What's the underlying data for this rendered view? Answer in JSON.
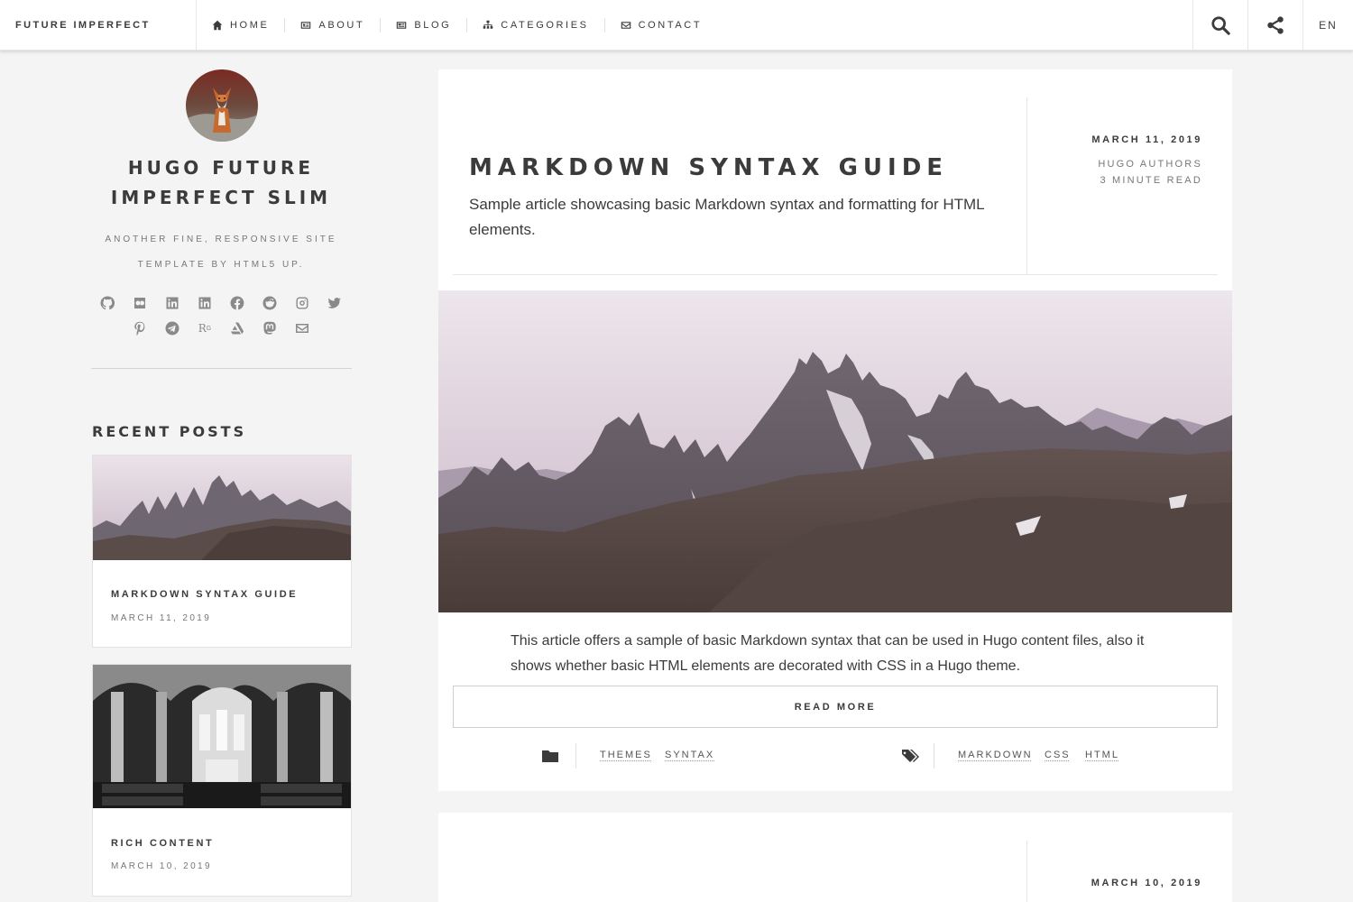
{
  "header": {
    "brand": "FUTURE IMPERFECT",
    "nav": [
      {
        "label": "HOME",
        "icon": "home-icon"
      },
      {
        "label": "ABOUT",
        "icon": "id-card-icon"
      },
      {
        "label": "BLOG",
        "icon": "newspaper-icon"
      },
      {
        "label": "CATEGORIES",
        "icon": "sitemap-icon"
      },
      {
        "label": "CONTACT",
        "icon": "envelope-icon"
      }
    ],
    "search_icon": "search-icon",
    "share_icon": "share-icon",
    "lang": "EN"
  },
  "sidebar": {
    "title": "HUGO FUTURE IMPERFECT SLIM",
    "description": "ANOTHER FINE, RESPONSIVE SITE TEMPLATE BY HTML5 UP.",
    "social_row1": [
      "github-icon",
      "flickr-icon",
      "linkedin-icon",
      "linkedin-square-icon",
      "facebook-icon",
      "reddit-icon",
      "instagram-icon",
      "twitter-icon"
    ],
    "social_row2": [
      "pinterest-icon",
      "telegram-icon",
      "researchgate-icon",
      "artstation-icon",
      "mastodon-icon",
      "email-icon"
    ],
    "researchgate_text": "R",
    "recent_title": "RECENT POSTS",
    "recent": [
      {
        "title": "MARKDOWN SYNTAX GUIDE",
        "date": "MARCH 11, 2019"
      },
      {
        "title": "RICH CONTENT",
        "date": "MARCH 10, 2019"
      }
    ]
  },
  "post": {
    "title": "MARKDOWN SYNTAX GUIDE",
    "subtitle": "Sample article showcasing basic Markdown syntax and formatting for HTML elements.",
    "date": "MARCH 11, 2019",
    "author": "HUGO AUTHORS",
    "read_time": "3 MINUTE READ",
    "excerpt": "This article offers a sample of basic Markdown syntax that can be used in Hugo content files, also it shows whether basic HTML elements are decorated with CSS in a Hugo theme.",
    "read_more": "READ MORE",
    "categories": [
      "THEMES",
      "SYNTAX"
    ],
    "tags": [
      "MARKDOWN",
      "CSS",
      "HTML"
    ]
  },
  "post2": {
    "date": "MARCH 10, 2019"
  }
}
